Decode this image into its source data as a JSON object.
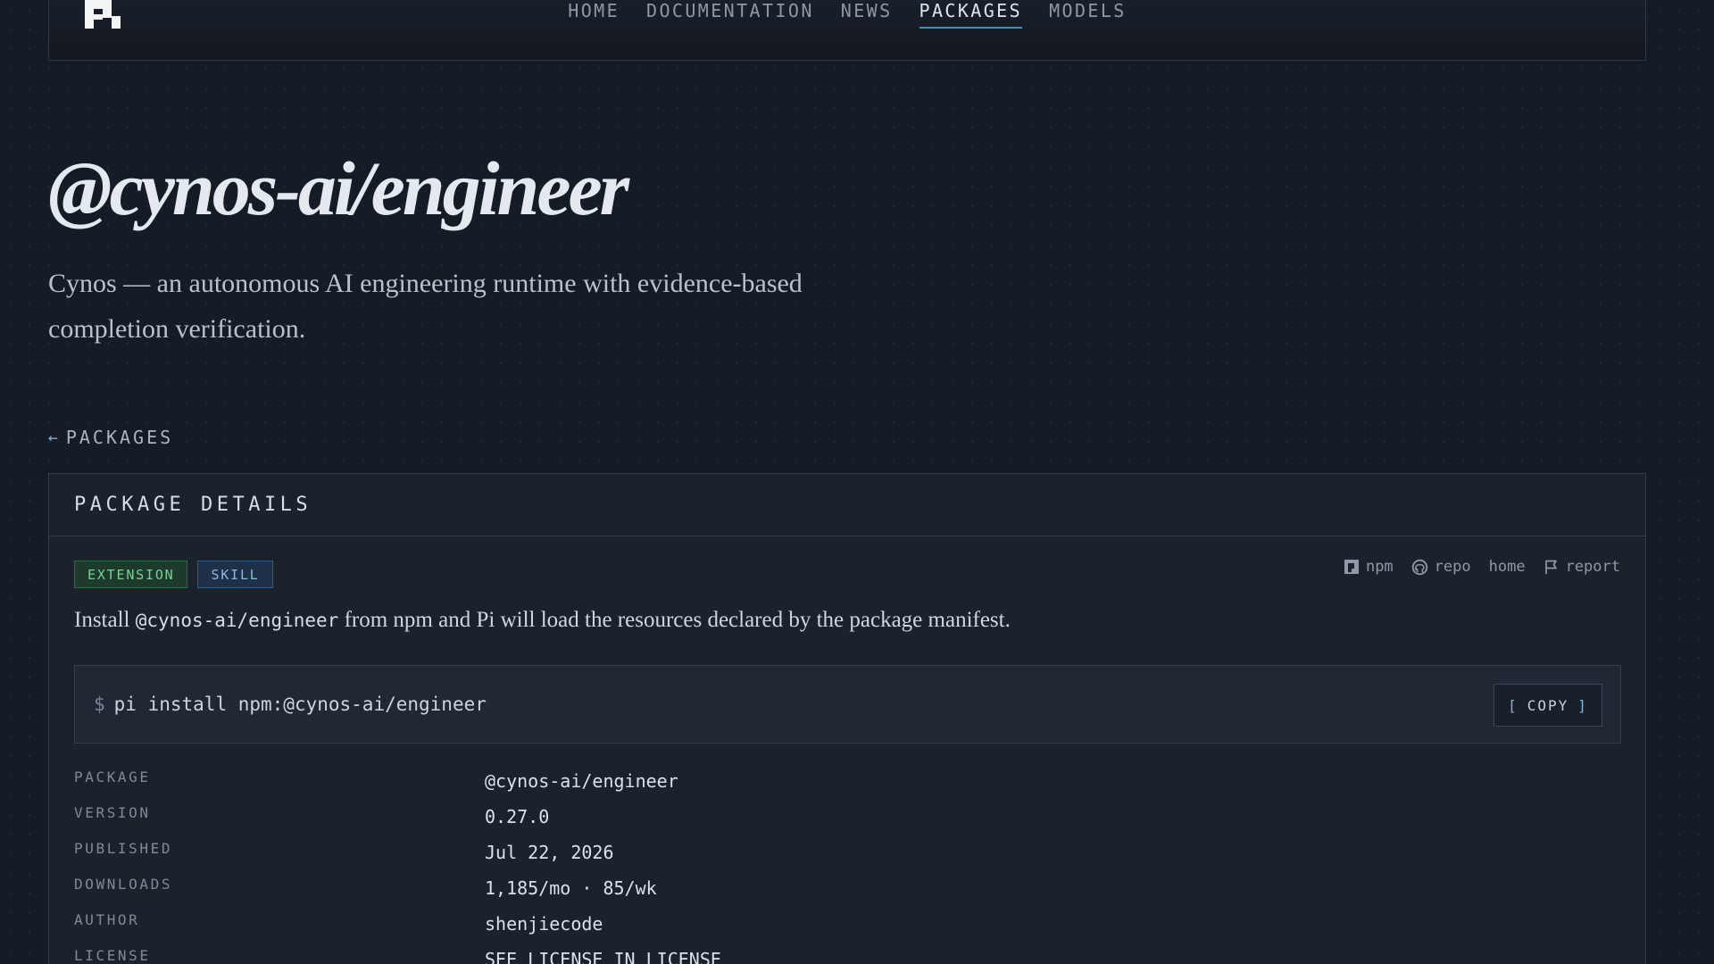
{
  "header": {
    "logo": "pi-logo",
    "nav": [
      {
        "label": "HOME",
        "active": false
      },
      {
        "label": "DOCUMENTATION",
        "active": false
      },
      {
        "label": "NEWS",
        "active": false
      },
      {
        "label": "PACKAGES",
        "active": true
      },
      {
        "label": "MODELS",
        "active": false
      }
    ]
  },
  "hero": {
    "title": "@cynos-ai/engineer",
    "subtitle": "Cynos — an autonomous AI engineering runtime with evidence-based completion verification."
  },
  "back_link": {
    "label": "PACKAGES",
    "icon": "arrow-left-icon"
  },
  "panel": {
    "title": "PACKAGE DETAILS",
    "badges": [
      "EXTENSION",
      "SKILL"
    ],
    "links": [
      {
        "label": "npm",
        "icon": "npm-icon"
      },
      {
        "label": "repo",
        "icon": "github-icon"
      },
      {
        "label": "home",
        "icon": ""
      },
      {
        "label": "report",
        "icon": "flag-icon"
      }
    ],
    "install_note": {
      "before": "Install ",
      "code": "@cynos-ai/engineer",
      "after": " from npm and Pi will load the resources declared by the package manifest."
    },
    "command": {
      "prompt": "$",
      "text": "pi install npm:@cynos-ai/engineer"
    },
    "copy_button": {
      "open": "[",
      "label": "COPY",
      "close": "]"
    },
    "meta": [
      {
        "key": "PACKAGE",
        "value": "@cynos-ai/engineer"
      },
      {
        "key": "VERSION",
        "value": "0.27.0"
      },
      {
        "key": "PUBLISHED",
        "value": "Jul 22, 2026"
      },
      {
        "key": "DOWNLOADS",
        "value": "1,185/mo · 85/wk"
      },
      {
        "key": "AUTHOR",
        "value": "shenjiecode"
      },
      {
        "key": "LICENSE",
        "value": "SEE LICENSE IN LICENSE"
      }
    ]
  },
  "colors": {
    "background": "#161c26",
    "accent": "#4c8fb6",
    "extension_badge": "#7ccf95",
    "skill_badge": "#8db8de"
  }
}
